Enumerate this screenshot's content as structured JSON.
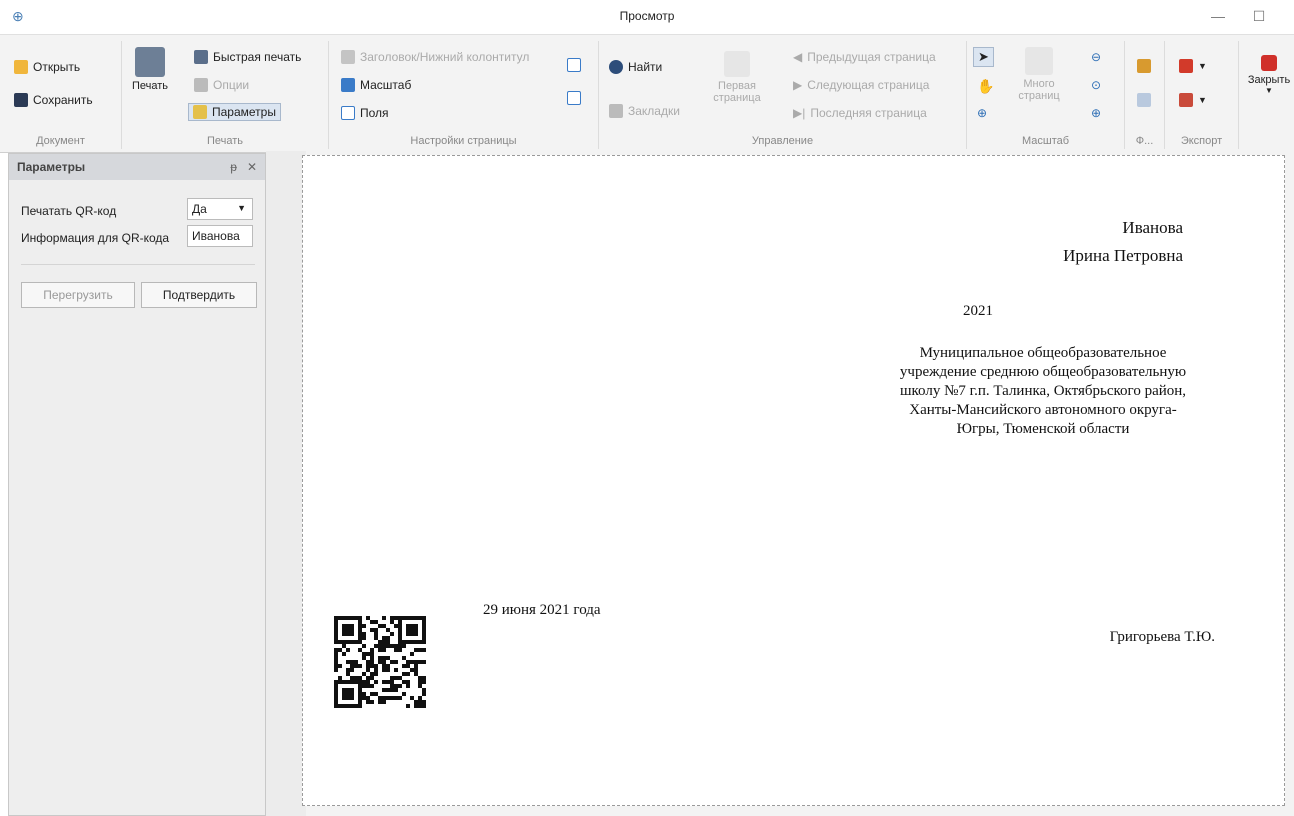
{
  "window": {
    "title": "Просмотр",
    "minimize": "—",
    "maximize": "☐"
  },
  "ribbon": {
    "document": {
      "label": "Документ",
      "open": "Открыть",
      "save": "Сохранить"
    },
    "print": {
      "label": "Печать",
      "print": "Печать",
      "quick_print": "Быстрая печать",
      "options": "Опции",
      "parameters": "Параметры"
    },
    "page_setup": {
      "label": "Настройки страницы",
      "header_footer": "Заголовок/Нижний колонтитул",
      "scale": "Масштаб",
      "margins": "Поля"
    },
    "navigation": {
      "label": "Управление",
      "find": "Найти",
      "bookmarks": "Закладки",
      "first_page_l1": "Первая",
      "first_page_l2": "страница",
      "prev_page": "Предыдущая страница",
      "next_page": "Следующая страница",
      "last_page": "Последняя страница"
    },
    "zoom": {
      "label": "Масштаб",
      "many_pages_l1": "Много",
      "many_pages_l2": "страниц"
    },
    "background": {
      "label": "Ф..."
    },
    "export": {
      "label": "Экспорт"
    },
    "close": {
      "label": "Закрыть"
    }
  },
  "parameters_panel": {
    "title": "Параметры",
    "pin": "ᵽ",
    "close": "✕",
    "print_qr_label": "Печатать QR-код",
    "print_qr_value": "Да",
    "qr_info_label": "Информация для QR-кода",
    "qr_info_value": "Иванова",
    "reload": "Перегрузить",
    "confirm": "Подтвердить"
  },
  "document": {
    "surname": "Иванова",
    "name": "Ирина  Петровна",
    "year": "2021",
    "org_lines": [
      "Муниципальное общеобразовательное",
      "учреждение среднюю общеобразовательную",
      "школу №7 г.п. Талинка, Октябрьского район,",
      "Ханты-Мансийского автономного округа-",
      "Югры, Тюменской области"
    ],
    "date": "29 июня 2021 года",
    "signer": "Григорьева Т.Ю."
  }
}
